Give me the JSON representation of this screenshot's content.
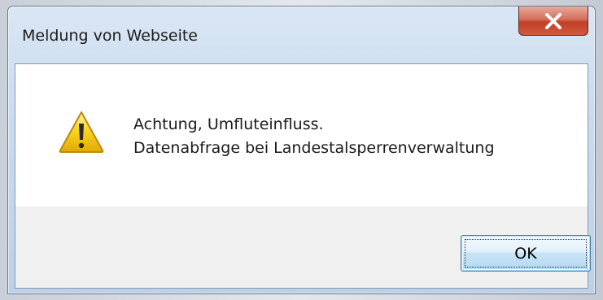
{
  "dialog": {
    "title": "Meldung von Webseite",
    "close_icon": "close-icon",
    "icon": "warning-icon",
    "message_line1": "Achtung, Umfluteinfluss.",
    "message_line2": "Datenabfrage bei Landestalsperrenverwaltung",
    "ok_label": "OK"
  },
  "colors": {
    "close_button": "#c74a30",
    "warning_yellow": "#f6d21a",
    "ok_border": "#3c7fb1"
  }
}
